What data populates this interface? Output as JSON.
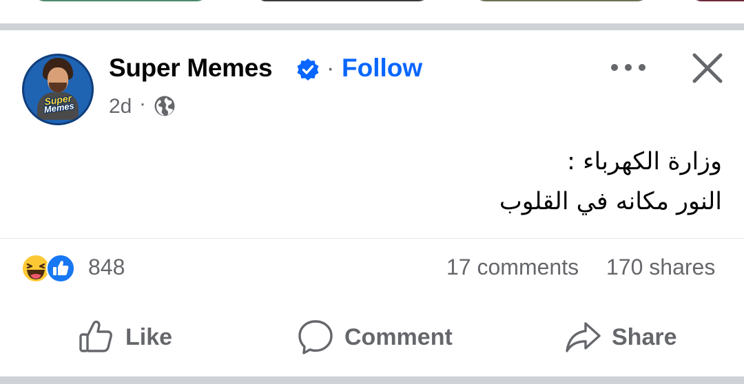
{
  "post": {
    "author": "Super Memes",
    "follow_label": "Follow",
    "separator": "·",
    "time": "2d",
    "avatar_text_line1": "Super",
    "avatar_text_line2": "Memes",
    "text_line1": "وزارة الكهرباء :",
    "text_line2": "النور مكانه في القلوب"
  },
  "stats": {
    "reaction_count": "848",
    "comments": "17 comments",
    "shares": "170 shares",
    "reactions": [
      "haha-icon",
      "like-icon"
    ]
  },
  "actions": {
    "like_label": "Like",
    "comment_label": "Comment",
    "share_label": "Share"
  },
  "colors": {
    "accent": "#0866ff",
    "secondary_text": "#65676b",
    "separator": "#cfd3d8"
  }
}
